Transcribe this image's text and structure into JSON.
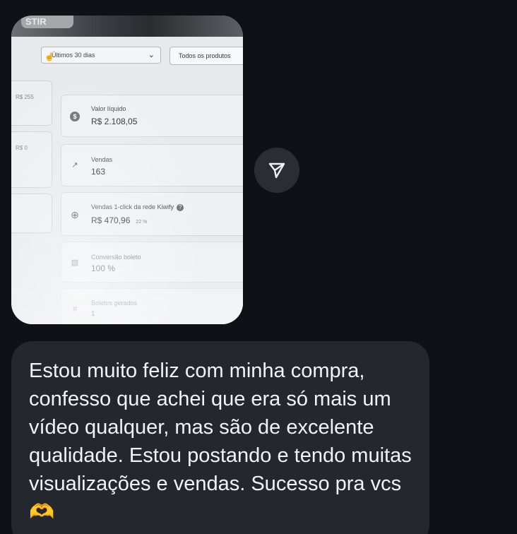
{
  "photo": {
    "top_tag": "STIR",
    "filter_period": "Últimos 30 dias",
    "filter_period_chevron": "⌄",
    "filter_products": "Todos os produtos",
    "left_values": [
      "R$ 255",
      "R$ 0"
    ],
    "cards": [
      {
        "icon": "dollar-icon",
        "glyph": "$",
        "label": "Valor líquido",
        "value": "R$ 2.108,05"
      },
      {
        "icon": "trend-up-icon",
        "glyph": "↗",
        "label": "Vendas",
        "value": "163"
      },
      {
        "icon": "globe-icon",
        "glyph": "⊕",
        "label": "Vendas 1-click da rede Kiwify",
        "help": "?",
        "value": "R$ 470,96",
        "pct": "22 %"
      },
      {
        "icon": "boleto-icon",
        "glyph": "▨",
        "label": "Conversão boleto",
        "value": "100 %"
      },
      {
        "icon": "hash-icon",
        "glyph": "#",
        "label": "Boletos gerados",
        "value": "1"
      }
    ]
  },
  "share_button": {
    "icon": "send-icon"
  },
  "message": {
    "text": "Estou muito feliz com minha compra, confesso que achei que era só mais um vídeo qualquer, mas são de excelente qualidade. Estou postando e tendo muitas visualizações e vendas. Sucesso pra vcs 🫶"
  }
}
